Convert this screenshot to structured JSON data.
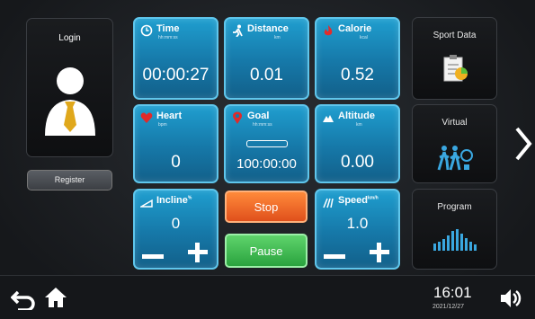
{
  "login": {
    "label": "Login",
    "register_label": "Register"
  },
  "tiles": {
    "time": {
      "label": "Time",
      "unit": "hh:mm:ss",
      "value": "00:00:27",
      "icon": "clock-icon"
    },
    "distance": {
      "label": "Distance",
      "unit": "km",
      "value": "0.01",
      "icon": "runner-icon"
    },
    "calorie": {
      "label": "Calorie",
      "unit": "kcal",
      "value": "0.52",
      "icon": "flame-icon"
    },
    "heart": {
      "label": "Heart",
      "unit": "bpm",
      "value": "0",
      "icon": "heart-icon"
    },
    "goal": {
      "label": "Goal",
      "unit": "hh:mm:ss",
      "value": "100:00:00",
      "icon": "pin-icon"
    },
    "altitude": {
      "label": "Altitude",
      "unit": "km",
      "value": "0.00",
      "icon": "mountain-icon"
    }
  },
  "incline": {
    "label": "Incline",
    "superscript": "%",
    "value": "0"
  },
  "speed": {
    "label": "Speed",
    "superscript": "km/h",
    "value": "1.0"
  },
  "buttons": {
    "stop": "Stop",
    "pause": "Pause"
  },
  "side": {
    "sport_data": "Sport Data",
    "virtual": "Virtual",
    "program": "Program"
  },
  "status": {
    "time": "16:01",
    "date": "2021/12/27"
  },
  "colors": {
    "tile": "#1678a8",
    "tile_border": "#5fc6ec",
    "stop": "#e8541e",
    "pause": "#33b34a",
    "heart": "#e02a2a"
  }
}
